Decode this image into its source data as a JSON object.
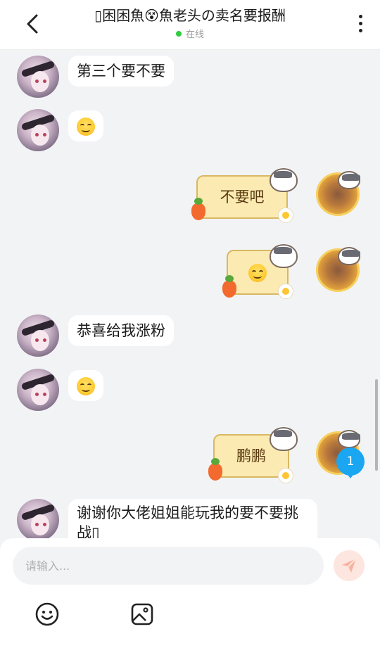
{
  "header": {
    "title": "▯困困魚😵魚老头の卖名要报酬",
    "status": "在线"
  },
  "messages": [
    {
      "side": "left",
      "text": "第三个要不要"
    },
    {
      "side": "left",
      "emoji": "grinning-face"
    },
    {
      "side": "right",
      "text": "不要吧"
    },
    {
      "side": "right",
      "emoji": "smiling-face"
    },
    {
      "side": "left",
      "text": "恭喜给我涨粉"
    },
    {
      "side": "left",
      "emoji": "smiling-face"
    },
    {
      "side": "right",
      "text": "鹏鹏"
    },
    {
      "side": "left",
      "text": "谢谢你大佬姐姐能玩我的要不要挑战▯"
    }
  ],
  "unread_count": "1",
  "composer": {
    "placeholder": "请输入...",
    "value": ""
  },
  "toolbar": {
    "emoji_icon": "smiley-icon",
    "image_icon": "image-icon",
    "send_icon": "send-icon"
  },
  "colors": {
    "accent_online": "#2ecc40",
    "badge": "#1aa6f0",
    "sticker_bubble": "#fbeab2"
  }
}
